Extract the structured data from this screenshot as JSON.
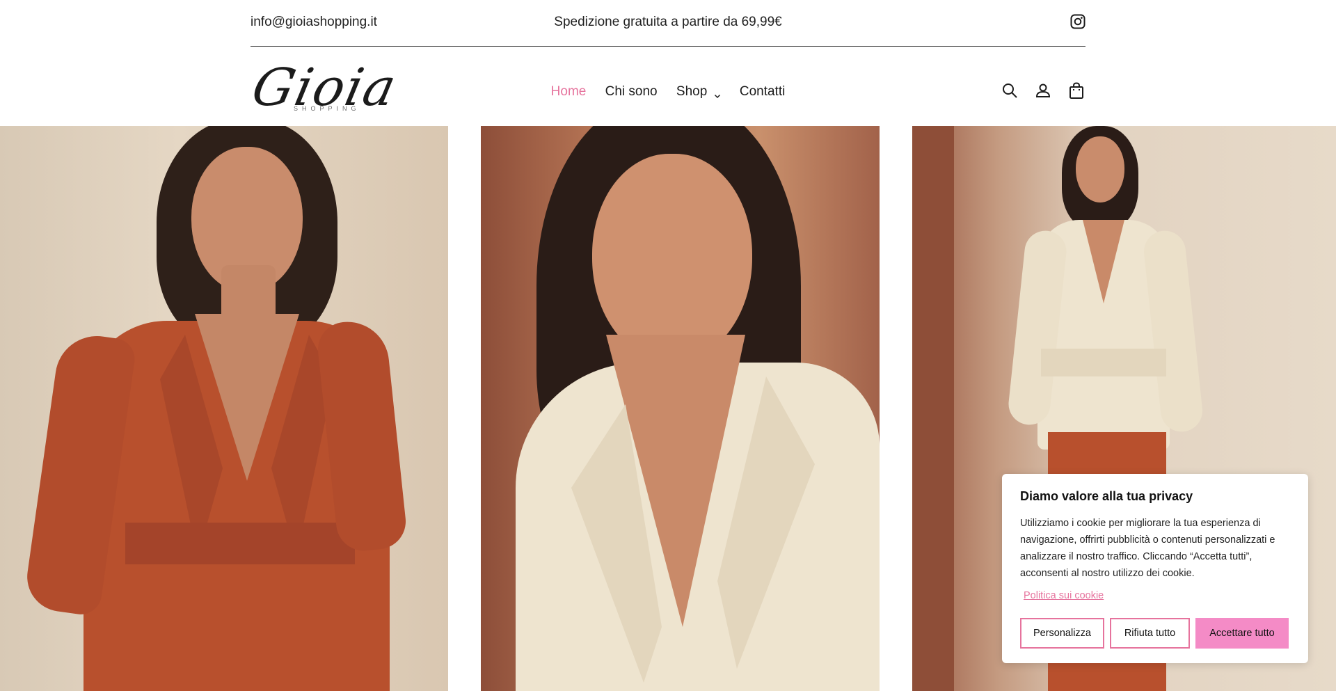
{
  "topbar": {
    "email": "info@gioiashopping.it",
    "shipping": "Spedizione gratuita a partire da 69,99€",
    "social_icon": "instagram-icon"
  },
  "header": {
    "logo_text": "Gioia",
    "logo_subtext": "SHOPPING",
    "nav": [
      {
        "label": "Home",
        "active": true
      },
      {
        "label": "Chi sono",
        "active": false
      },
      {
        "label": "Shop",
        "active": false,
        "dropdown": true
      },
      {
        "label": "Contatti",
        "active": false
      }
    ],
    "icons": [
      "search-icon",
      "account-icon",
      "cart-icon"
    ],
    "accent_color": "#e6739d"
  },
  "gallery": {
    "panels": [
      {
        "description_color": "#b8502d"
      },
      {
        "description_color": "#eee4cf"
      },
      {
        "description_color": "#eee4cf"
      }
    ]
  },
  "cookie": {
    "title": "Diamo valore alla tua privacy",
    "text": "Utilizziamo i cookie per migliorare la tua esperienza di navigazione, offrirti pubblicità o contenuti personalizzati e analizzare il nostro traffico. Cliccando “Accetta tutti”, acconsenti al nostro utilizzo dei cookie.",
    "policy_link": "Politica sui cookie",
    "buttons": {
      "customize": "Personalizza",
      "reject": "Rifiuta tutto",
      "accept": "Accettare tutto"
    },
    "accent_color": "#f48bc6"
  }
}
